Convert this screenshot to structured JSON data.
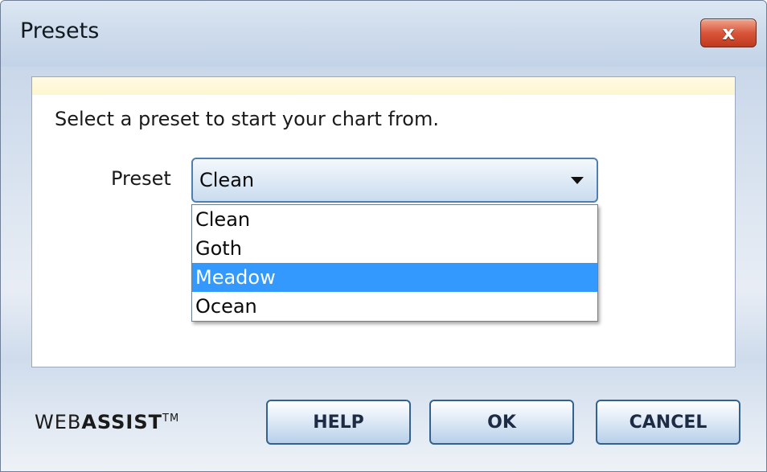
{
  "window": {
    "title": "Presets",
    "close_label": "x"
  },
  "panel": {
    "instruction": "Select a preset to start your chart from.",
    "preset_label": "Preset",
    "select": {
      "value": "Clean",
      "options": [
        "Clean",
        "Goth",
        "Meadow",
        "Ocean"
      ],
      "highlighted": "Meadow"
    }
  },
  "footer": {
    "logo_light": "WEB",
    "logo_bold": "ASSIST",
    "logo_tm": "TM",
    "help_label": "HELP",
    "ok_label": "OK",
    "cancel_label": "CANCEL"
  },
  "colors": {
    "highlight": "#3399ff",
    "close_button": "#d8553a"
  }
}
